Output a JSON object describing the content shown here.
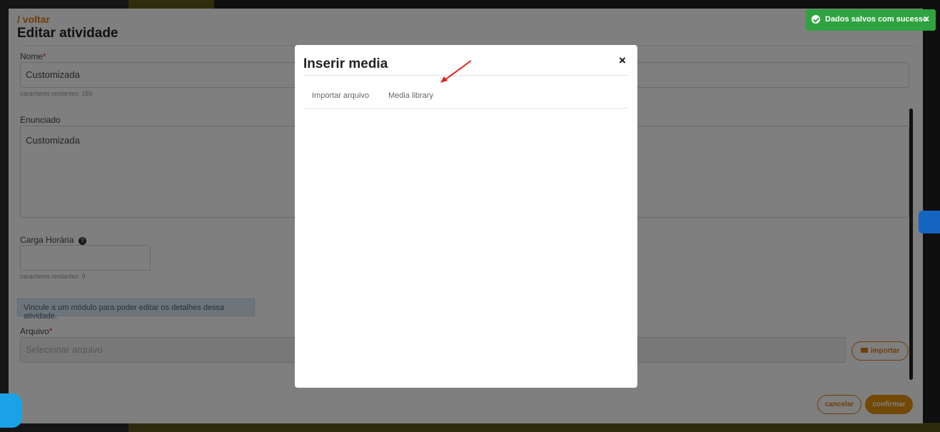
{
  "page": {
    "back_link": "/ voltar",
    "title": "Editar atividade"
  },
  "form": {
    "name_label": "Nome",
    "required_mark": "*",
    "name_value": "Customizada",
    "name_hint": "caracteres restantes: 189",
    "statement_label": "Enunciado",
    "statement_value": "Customizada",
    "workload_label": "Carga Horária",
    "workload_value": "",
    "workload_hint": "caracteres restantes: 9",
    "info_message": "Vincule a um módulo para poder editar os detalhes dessa atividade.",
    "file_label": "Arquivo",
    "file_placeholder": "Selecionar arquivo",
    "import_label": "importar",
    "cancel_label": "cancelar",
    "confirm_label": "confirmar"
  },
  "modal": {
    "title": "Inserir media",
    "close_glyph": "×",
    "tabs": [
      "Importar arquivo",
      "Media library"
    ]
  },
  "toast": {
    "message": "Dados salvos com sucesso",
    "close_glyph": "×"
  },
  "colors": {
    "accent": "#e07b12",
    "success": "#2fa33f",
    "info_bg": "#dbe9f5",
    "arrow": "#e02020"
  }
}
